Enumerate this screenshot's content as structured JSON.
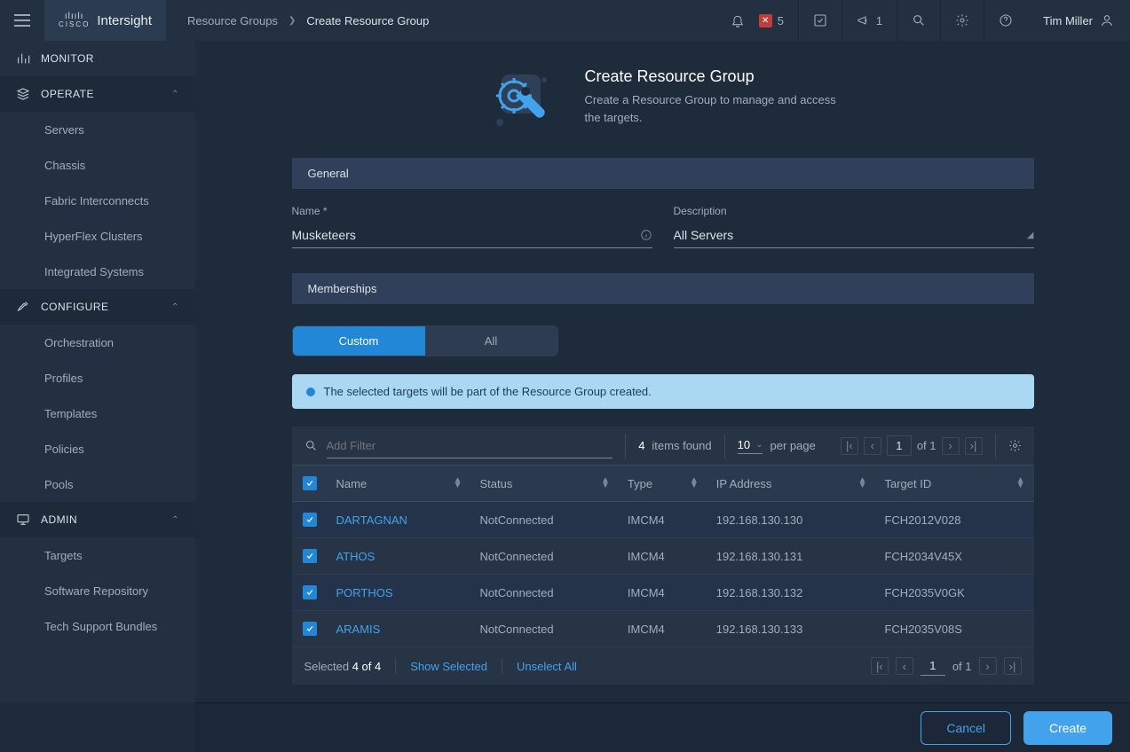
{
  "brand": {
    "vendor_top": "ılıılı",
    "vendor_bottom": "CISCO",
    "product": "Intersight"
  },
  "breadcrumb": {
    "parent": "Resource Groups",
    "current": "Create Resource Group"
  },
  "topbar": {
    "alert_count": "5",
    "announce_count": "1",
    "user_name": "Tim Miller"
  },
  "sidebar": {
    "monitor": "MONITOR",
    "operate": {
      "label": "OPERATE",
      "items": [
        "Servers",
        "Chassis",
        "Fabric Interconnects",
        "HyperFlex Clusters",
        "Integrated Systems"
      ]
    },
    "configure": {
      "label": "CONFIGURE",
      "items": [
        "Orchestration",
        "Profiles",
        "Templates",
        "Policies",
        "Pools"
      ]
    },
    "admin": {
      "label": "ADMIN",
      "items": [
        "Targets",
        "Software Repository",
        "Tech Support Bundles"
      ]
    }
  },
  "page": {
    "title": "Create Resource Group",
    "subtitle": "Create a Resource Group to manage and access the targets."
  },
  "sections": {
    "general": "General",
    "memberships": "Memberships"
  },
  "form": {
    "name_label": "Name *",
    "name_value": "Musketeers",
    "desc_label": "Description",
    "desc_value": "All Servers"
  },
  "segments": {
    "custom": "Custom",
    "all": "All"
  },
  "info_banner": "The selected targets will be part of the Resource Group created.",
  "table": {
    "filter_placeholder": "Add Filter",
    "found_count": "4",
    "found_label": " items found",
    "per_page_value": "10",
    "per_page_label": "per page",
    "page_current": "1",
    "page_of": "of 1",
    "columns": [
      "Name",
      "Status",
      "Type",
      "IP Address",
      "Target ID"
    ],
    "rows": [
      {
        "name": "DARTAGNAN",
        "status": "NotConnected",
        "type": "IMCM4",
        "ip": "192.168.130.130",
        "target_id": "FCH2012V028"
      },
      {
        "name": "ATHOS",
        "status": "NotConnected",
        "type": "IMCM4",
        "ip": "192.168.130.131",
        "target_id": "FCH2034V45X"
      },
      {
        "name": "PORTHOS",
        "status": "NotConnected",
        "type": "IMCM4",
        "ip": "192.168.130.132",
        "target_id": "FCH2035V0GK"
      },
      {
        "name": "ARAMIS",
        "status": "NotConnected",
        "type": "IMCM4",
        "ip": "192.168.130.133",
        "target_id": "FCH2035V08S"
      }
    ],
    "footer": {
      "selected_prefix": "Selected ",
      "selected_count": "4 of 4",
      "show_selected": "Show Selected",
      "unselect_all": "Unselect All",
      "page_current": "1",
      "page_of": "of 1"
    }
  },
  "actions": {
    "cancel": "Cancel",
    "create": "Create"
  }
}
